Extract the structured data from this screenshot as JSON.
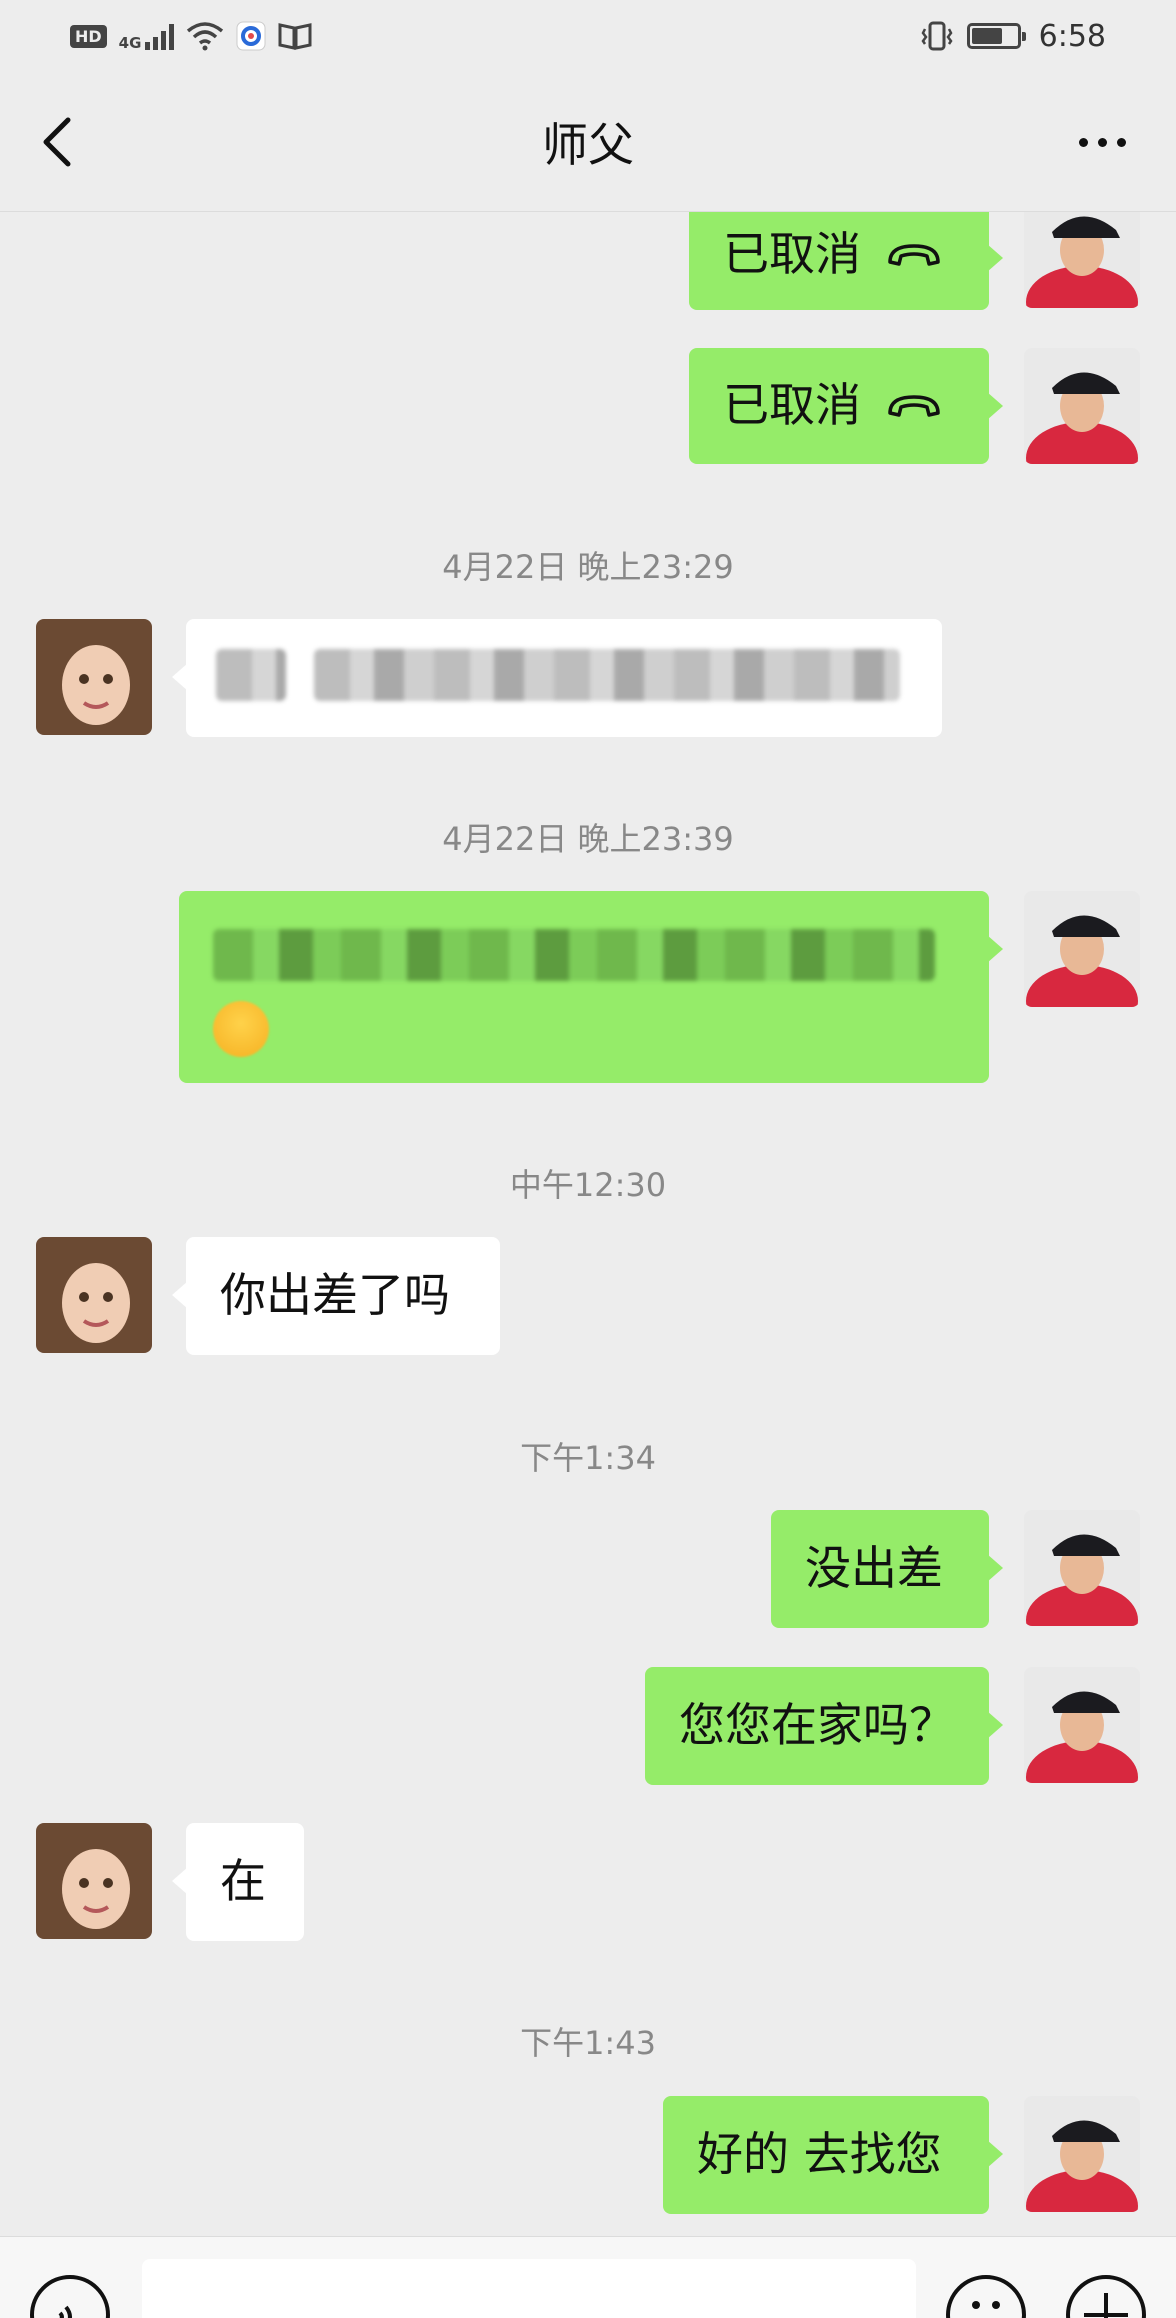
{
  "status_bar": {
    "hd": "HD",
    "network": "4G",
    "time": "6:58"
  },
  "header": {
    "title": "师父"
  },
  "messages": [
    {
      "type": "call",
      "side": "mine",
      "text": "已取消"
    },
    {
      "type": "call",
      "side": "mine",
      "text": "已取消"
    },
    {
      "type": "time",
      "text": "4月22日 晚上23:29"
    },
    {
      "type": "redacted",
      "side": "theirs"
    },
    {
      "type": "time",
      "text": "4月22日 晚上23:39"
    },
    {
      "type": "redacted",
      "side": "mine"
    },
    {
      "type": "time",
      "text": "中午12:30"
    },
    {
      "type": "text",
      "side": "theirs",
      "text": "你出差了吗"
    },
    {
      "type": "time",
      "text": "下午1:34"
    },
    {
      "type": "text",
      "side": "mine",
      "text": "没出差"
    },
    {
      "type": "text",
      "side": "mine",
      "text": "您您在家吗？"
    },
    {
      "type": "text",
      "side": "theirs",
      "text": "在"
    },
    {
      "type": "time",
      "text": "下午1:43"
    },
    {
      "type": "text",
      "side": "mine",
      "text": "好的 去找您"
    }
  ],
  "colors": {
    "background": "#ededed",
    "my_bubble": "#95ec69",
    "their_bubble": "#ffffff",
    "timestamp": "#888888"
  },
  "icons": {
    "back": "chevron-left-icon",
    "more": "more-dots-icon",
    "call": "hangup-phone-icon",
    "voice": "voice-icon",
    "emoji": "emoji-icon",
    "plus": "plus-icon"
  }
}
